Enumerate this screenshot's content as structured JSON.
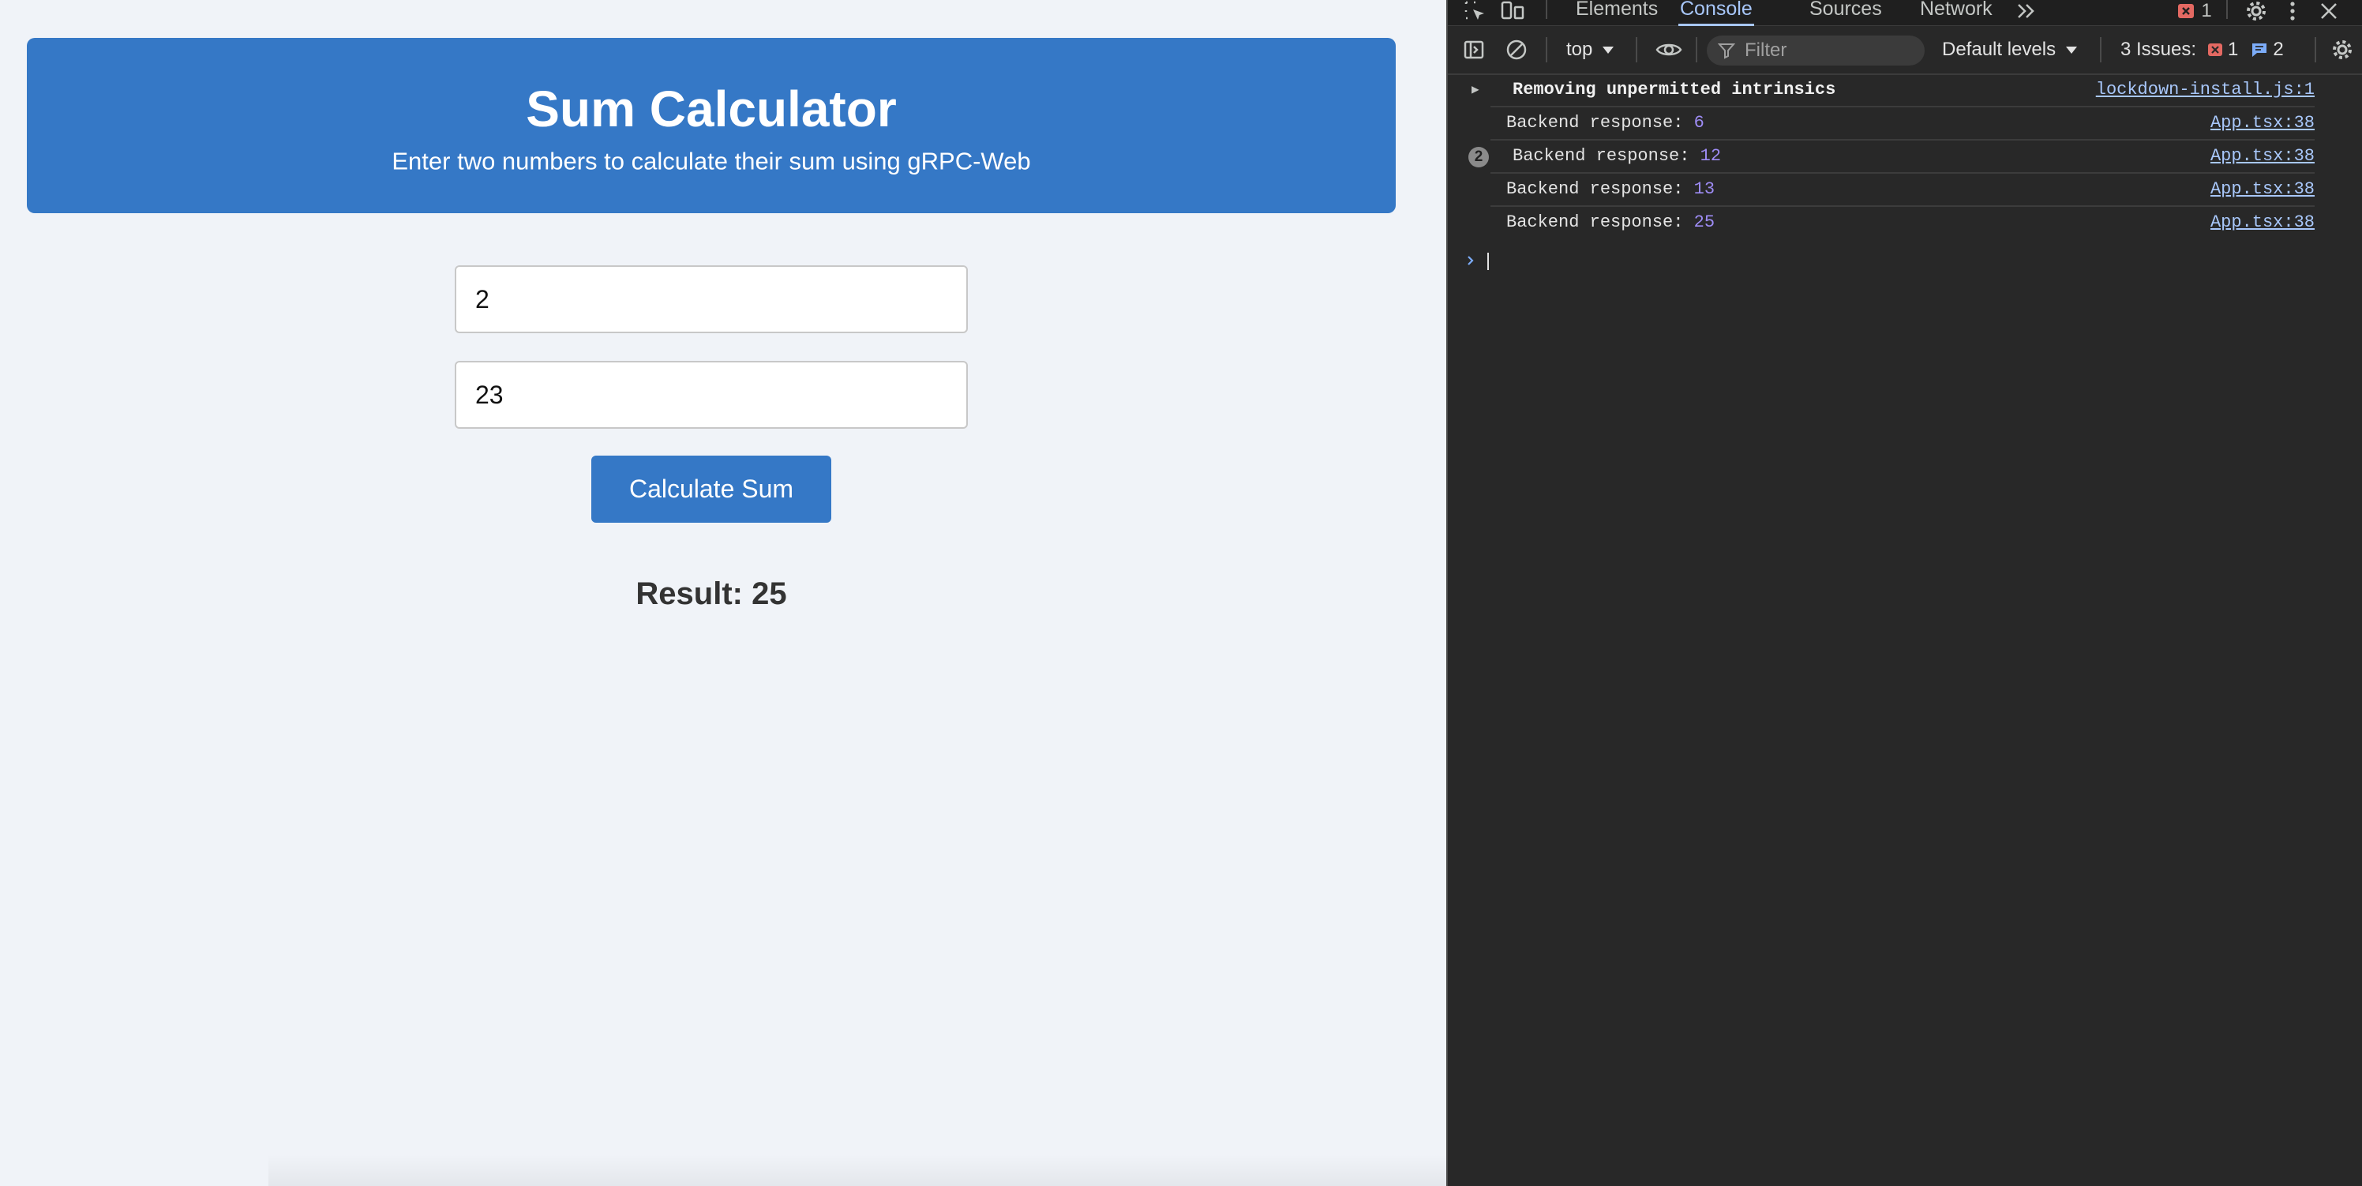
{
  "app": {
    "title": "Sum Calculator",
    "subtitle": "Enter two numbers to calculate their sum using gRPC-Web",
    "input_a_value": "2",
    "input_b_value": "23",
    "button_label": "Calculate Sum",
    "result_text": "Result: 25"
  },
  "devtools": {
    "tabs": [
      "Elements",
      "Console",
      "Sources",
      "Network"
    ],
    "active_tab": "Console",
    "error_count": "1",
    "toolbar": {
      "context": "top",
      "filter_placeholder": "Filter",
      "levels": "Default levels",
      "issues_label": "3 Issues:",
      "issues_errors": "1",
      "issues_messages": "2"
    },
    "logs": [
      {
        "message": "Removing unpermitted intrinsics",
        "source": "lockdown-install.js:1"
      },
      {
        "label": "Backend response: ",
        "value": "6",
        "source": "App.tsx:38"
      },
      {
        "label": "Backend response: ",
        "value": "12",
        "source": "App.tsx:38",
        "repeat": "2"
      },
      {
        "label": "Backend response: ",
        "value": "13",
        "source": "App.tsx:38"
      },
      {
        "label": "Backend response: ",
        "value": "25",
        "source": "App.tsx:38"
      }
    ]
  },
  "colors": {
    "accent_blue": "#3578c6",
    "page_bg": "#f0f3f8",
    "devtools_bg": "#282828",
    "link_blue": "#a8c7fa",
    "number_purple": "#9e8cf5",
    "error_red": "#e46962"
  },
  "icons": [
    "inspect-icon",
    "device-toolbar-icon",
    "more-tabs-icon",
    "error-icon",
    "settings-icon",
    "kebab-menu-icon",
    "close-icon",
    "sidebar-toggle-icon",
    "clear-console-icon",
    "eye-icon",
    "filter-icon",
    "message-icon",
    "console-prompt-icon"
  ]
}
